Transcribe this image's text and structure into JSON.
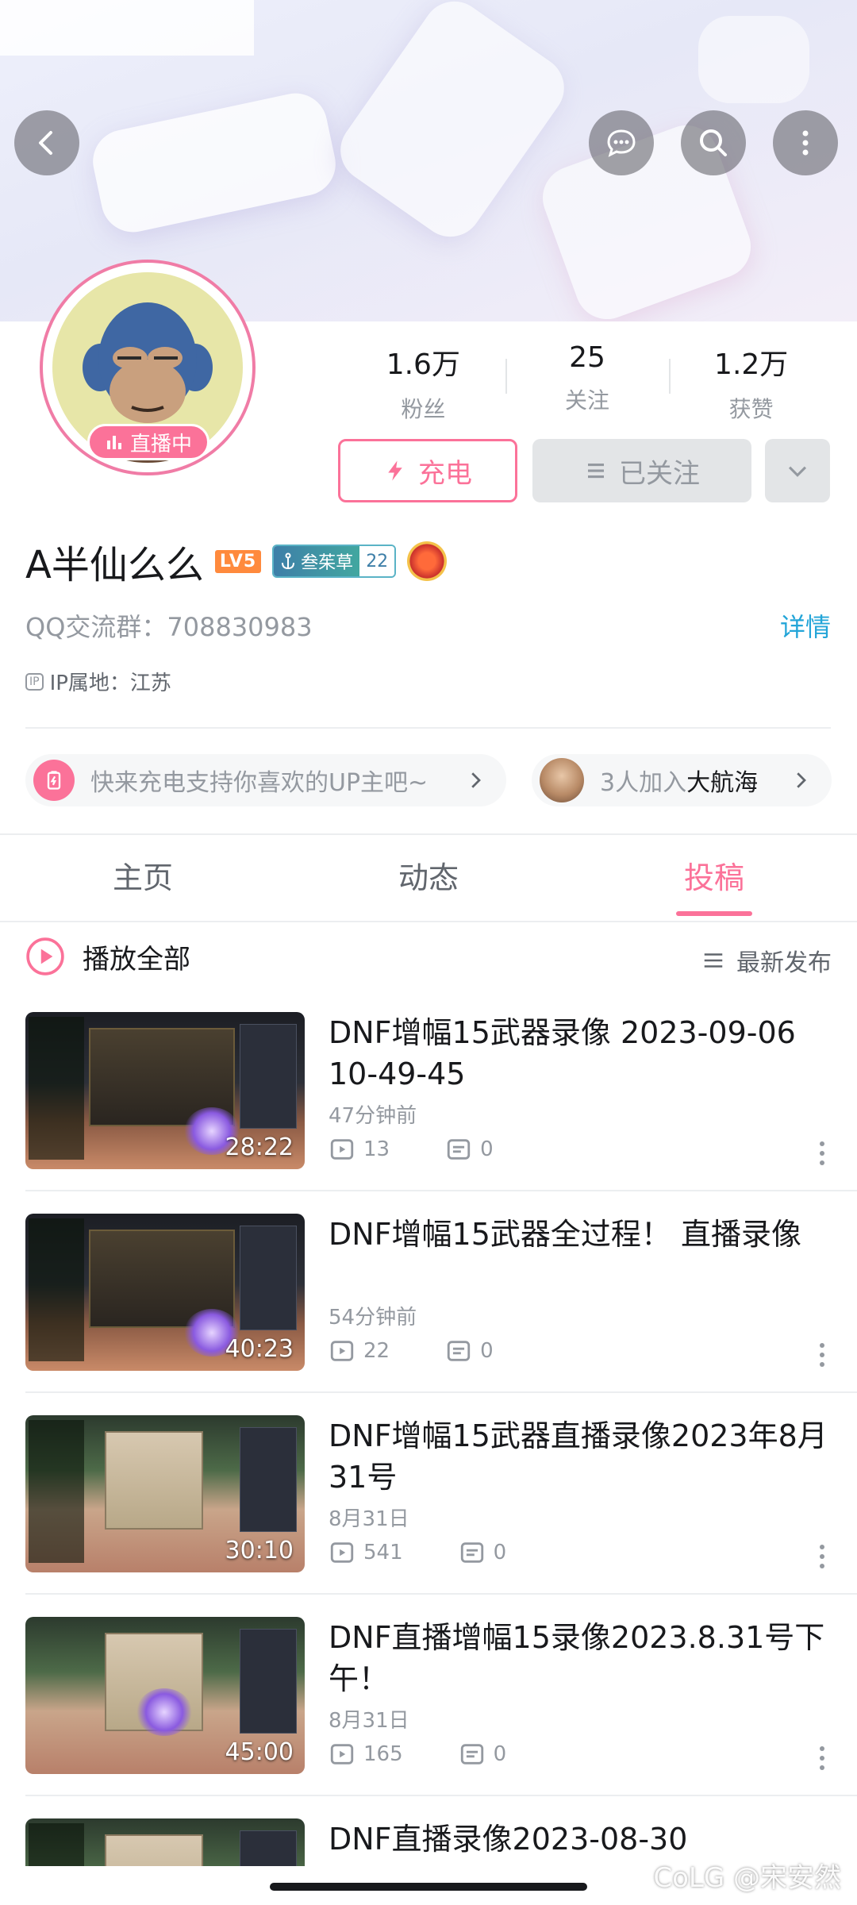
{
  "header": {
    "back_icon": "back-icon",
    "message_icon": "message-icon",
    "search_icon": "search-icon",
    "more_icon": "more-vertical-icon"
  },
  "profile": {
    "live_badge": "直播中",
    "stats": [
      {
        "value": "1.6万",
        "label": "粉丝"
      },
      {
        "value": "25",
        "label": "关注"
      },
      {
        "value": "1.2万",
        "label": "获赞"
      }
    ],
    "charge_label": "充电",
    "followed_label": "已关注",
    "username": "A半仙么么",
    "level": "LV5",
    "medal_name": "叁茱草",
    "medal_level": "22",
    "signature": "QQ交流群：708830983",
    "detail_link": "详情",
    "ip_tag": "IP",
    "ip_location": "IP属地：江苏"
  },
  "promo": {
    "charge_text": "快来充电支持你喜欢的UP主吧~",
    "fleet_prefix": "3人加入",
    "fleet_name": "大航海"
  },
  "tabs": [
    {
      "label": "主页",
      "active": false
    },
    {
      "label": "动态",
      "active": false
    },
    {
      "label": "投稿",
      "active": true
    }
  ],
  "list_header": {
    "play_all": "播放全部",
    "sort": "最新发布"
  },
  "videos": [
    {
      "title": "DNF增幅15武器录像 2023-09-06 10-49-45",
      "duration": "28:22",
      "time": "47分钟前",
      "views": "13",
      "comments": "0"
    },
    {
      "title": "DNF增幅15武器全过程！ 直播录像",
      "duration": "40:23",
      "time": "54分钟前",
      "views": "22",
      "comments": "0"
    },
    {
      "title": "DNF增幅15武器直播录像2023年8月31号",
      "duration": "30:10",
      "time": "8月31日",
      "views": "541",
      "comments": "0"
    },
    {
      "title": "DNF直播增幅15录像2023.8.31号下午！",
      "duration": "45:00",
      "time": "8月31日",
      "views": "165",
      "comments": "0"
    },
    {
      "title": "DNF直播录像2023-08-30",
      "duration": "",
      "time": "",
      "views": "",
      "comments": ""
    }
  ],
  "watermark": "CoLG @宋安然",
  "colors": {
    "accent": "#fb7299",
    "link": "#23a5d8",
    "text_primary": "#18191c",
    "text_secondary": "#9499a0"
  }
}
